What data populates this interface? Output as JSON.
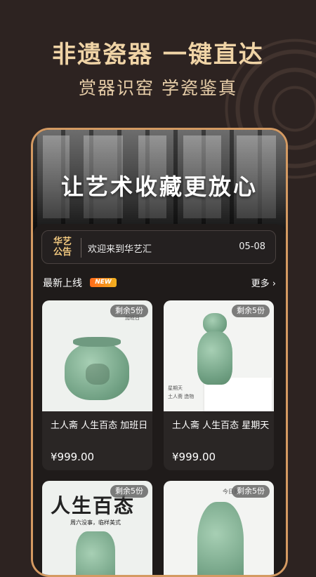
{
  "promo": {
    "headline": "非遗瓷器 一键直达",
    "subline": "赏器识窑 学瓷鉴真"
  },
  "banner": {
    "title": "让艺术收藏更放心"
  },
  "notice": {
    "badge_line1": "华艺",
    "badge_line2": "公告",
    "text": "欢迎来到华艺汇",
    "date": "05-08"
  },
  "section": {
    "title": "最新上线",
    "new_badge": "NEW",
    "more": "更多 ›"
  },
  "products": [
    {
      "stock": "剩余5份",
      "title": "土人斋 人生百态 加班日",
      "price": "¥999.00",
      "img_caption": "加班日"
    },
    {
      "stock": "剩余5份",
      "title": "土人斋 人生百态 星期天",
      "price": "¥999.00",
      "img_caption1": "星期天",
      "img_caption2": "土人斋 造物"
    },
    {
      "stock": "剩余5份",
      "poster_title": "人生百态",
      "poster_sub": "周六没事，临样美式"
    },
    {
      "stock": "剩余5份",
      "img_caption": "今日周五"
    }
  ],
  "colors": {
    "page_bg": "#2d2321",
    "headline": "#f0d4a6",
    "frame_border": "#d49a62",
    "badge_gold": "#f1c87f",
    "celadon": "#7fae90"
  }
}
